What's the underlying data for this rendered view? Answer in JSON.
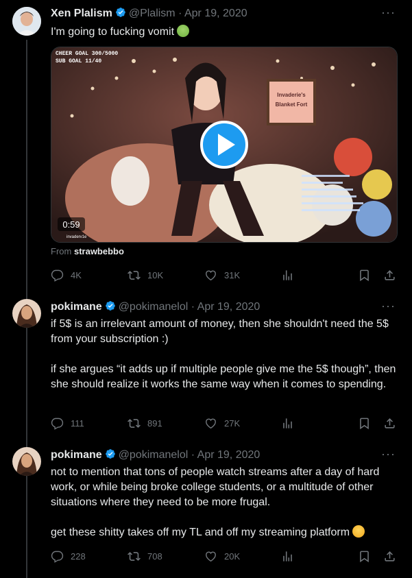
{
  "tweets": [
    {
      "name": "Xen Plalism",
      "handle": "@Plalism",
      "date": "Apr 19, 2020",
      "text": "I'm going to fucking vomit",
      "media": {
        "overlay_line1": "CHEER GOAL 300/5000",
        "overlay_line2": "SUB GOAL 11/40",
        "sign_line1": "Invaderie's",
        "sign_line2": "Blanket Fort",
        "duration": "0:59",
        "watermark": "invaderv1e",
        "from_label": "From",
        "from_user": "strawbebbo"
      },
      "stats": {
        "replies": "4K",
        "retweets": "10K",
        "likes": "31K"
      }
    },
    {
      "name": "pokimane",
      "handle": "@pokimanelol",
      "date": "Apr 19, 2020",
      "text": "if 5$ is an irrelevant amount of money, then she shouldn't need the 5$ from your subscription :)\n\nif she argues “it adds up if multiple people give me the 5$ though”, then she should realize it works the same way when it comes to spending.",
      "stats": {
        "replies": "111",
        "retweets": "891",
        "likes": "27K"
      }
    },
    {
      "name": "pokimane",
      "handle": "@pokimanelol",
      "date": "Apr 19, 2020",
      "text": "not to mention that tons of people watch streams after a day of hard work, or while being broke college students, or a multitude of other situations where they need to be more frugal.\n\nget these shitty takes off my TL and off my streaming platform",
      "stats": {
        "replies": "228",
        "retweets": "708",
        "likes": "20K"
      }
    }
  ],
  "colors": {
    "background": "#000000",
    "text": "#e7e9ea",
    "muted": "#71767b",
    "verified": "#1d9bf0",
    "thread_line": "#333639"
  }
}
